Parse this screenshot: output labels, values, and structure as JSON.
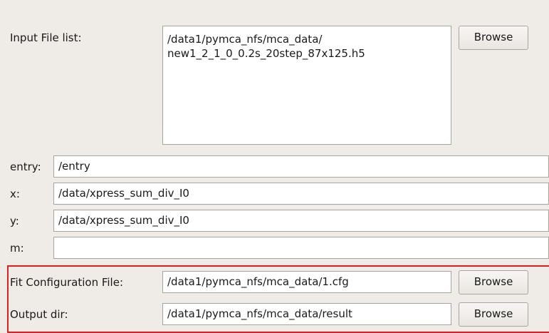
{
  "input_file_list": {
    "label": "Input File list:",
    "lines": [
      "/data1/pymca_nfs/mca_data/",
      "new1_2_1_0_0.2s_20step_87x125.h5"
    ],
    "browse_label": "Browse"
  },
  "entry": {
    "label": "entry:",
    "value": "/entry"
  },
  "x": {
    "label": "x:",
    "value": "/data/xpress_sum_div_I0"
  },
  "y": {
    "label": "y:",
    "value": "/data/xpress_sum_div_I0"
  },
  "m": {
    "label": "m:",
    "value": ""
  },
  "fit_config": {
    "label": "Fit Configuration File:",
    "value": "/data1/pymca_nfs/mca_data/1.cfg",
    "browse_label": "Browse"
  },
  "output_dir": {
    "label": "Output dir:",
    "value": "/data1/pymca_nfs/mca_data/result",
    "browse_label": "Browse"
  },
  "colors": {
    "background": "#efebe7",
    "highlight_border": "#e02020"
  }
}
